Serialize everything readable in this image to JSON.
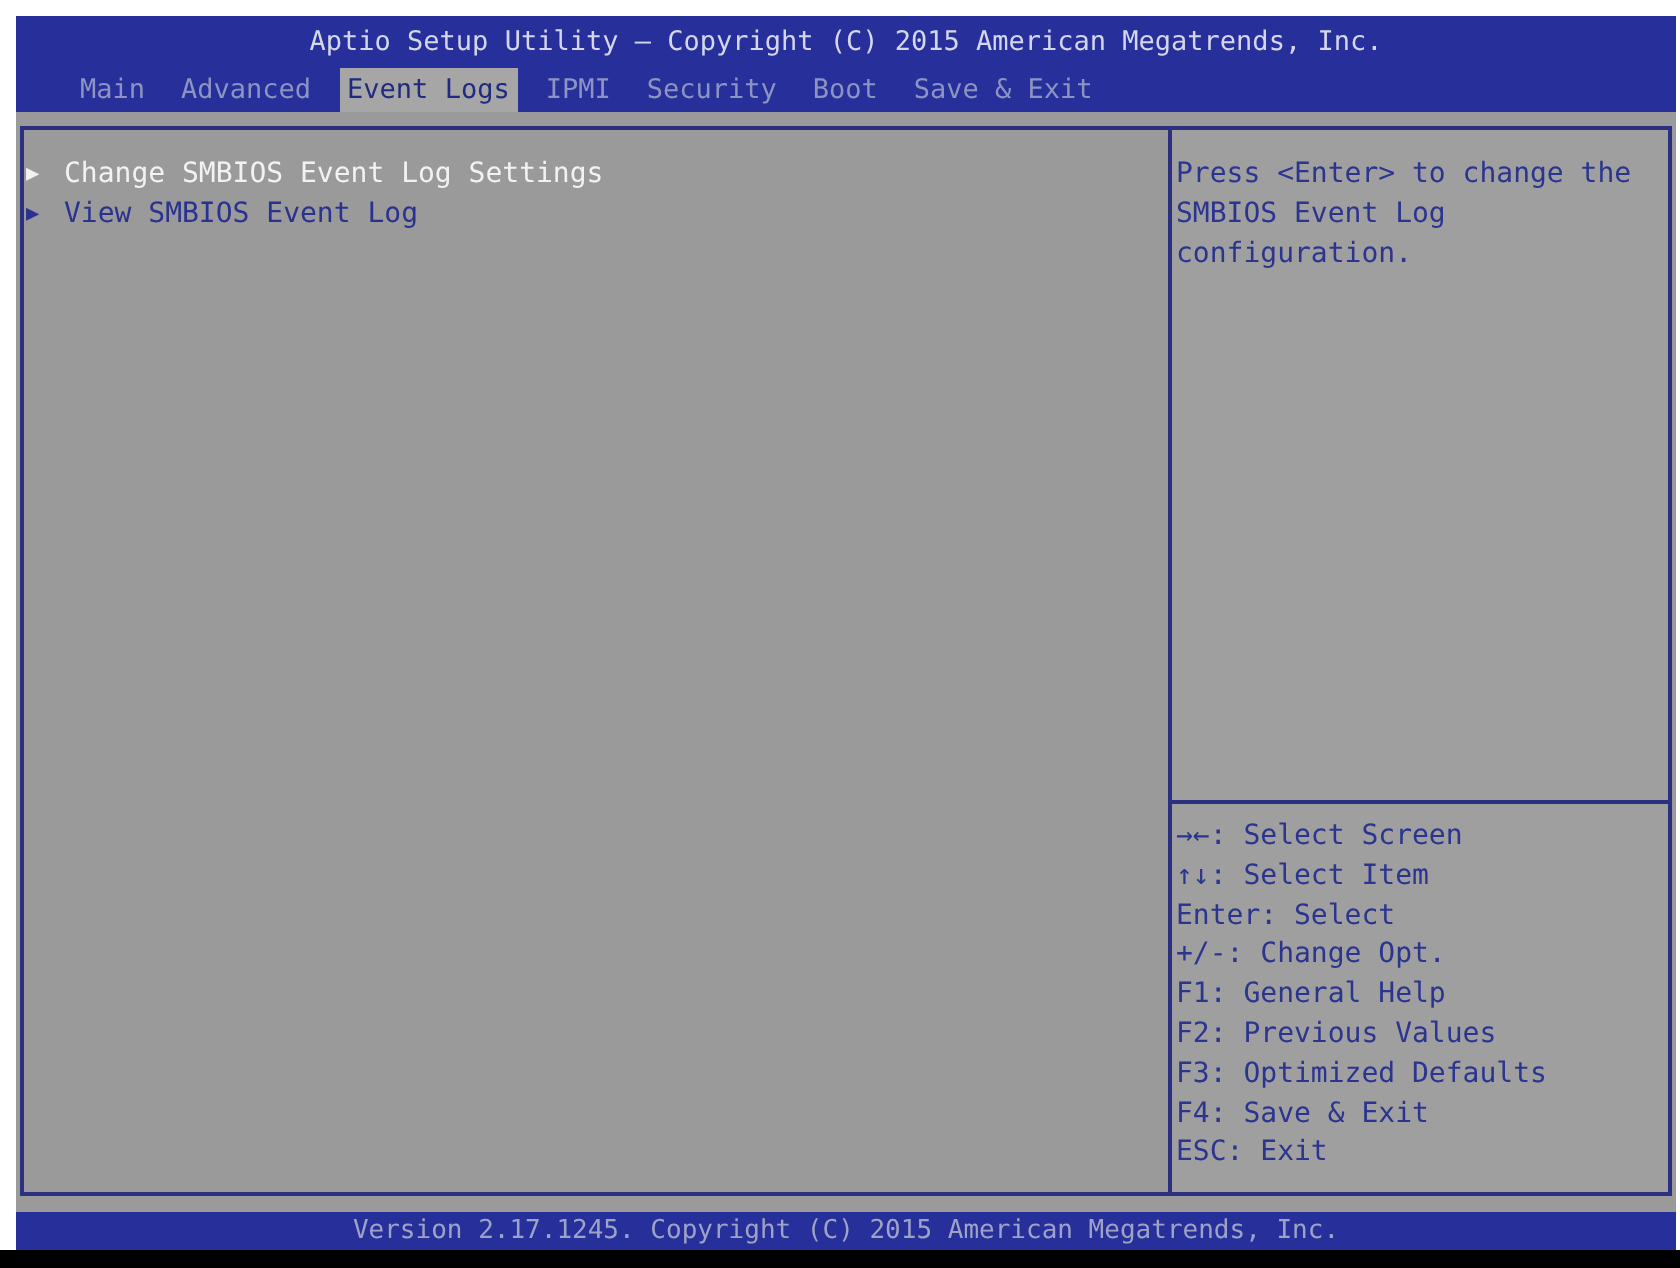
{
  "window": {
    "title": "Aptio Setup Utility – Copyright (C) 2015 American Megatrends, Inc."
  },
  "tabs": [
    {
      "label": "Main",
      "selected": false
    },
    {
      "label": "Advanced",
      "selected": false
    },
    {
      "label": "Event Logs",
      "selected": true
    },
    {
      "label": "IPMI",
      "selected": false
    },
    {
      "label": "Security",
      "selected": false
    },
    {
      "label": "Boot",
      "selected": false
    },
    {
      "label": "Save & Exit",
      "selected": false
    }
  ],
  "menu_items": [
    {
      "marker": "▶",
      "label": "Change SMBIOS Event Log Settings",
      "selected": true
    },
    {
      "marker": "▶",
      "label": "View SMBIOS Event Log",
      "selected": false
    }
  ],
  "help_text": "Press <Enter> to change the SMBIOS Event Log configuration.",
  "key_help": [
    "→←: Select Screen",
    "↑↓: Select Item",
    "Enter: Select",
    "+/-: Change Opt.",
    "F1: General Help",
    "F2: Previous Values",
    "F3: Optimized Defaults",
    "F4: Save & Exit",
    "ESC: Exit"
  ],
  "status_bar": "Version 2.17.1245. Copyright (C) 2015 American Megatrends, Inc."
}
